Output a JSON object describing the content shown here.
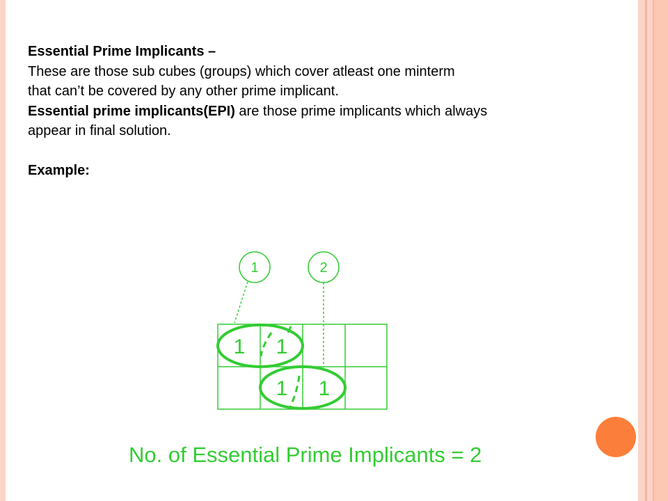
{
  "heading": "Essential Prime Implicants –",
  "line1": "These are those sub cubes (groups) which cover atleast one minterm",
  "line2": "that can’t be covered by any other prime implicant.",
  "epi_bold": "Essential prime implicants(EPI)",
  "epi_rest": " are those prime implicants which always",
  "line4": "appear in final solution.",
  "example_label": "Example:",
  "kmap": {
    "callout_1": "1",
    "callout_2": "2",
    "row1": [
      "1",
      "1",
      "",
      ""
    ],
    "row2": [
      "",
      "1",
      "1",
      ""
    ]
  },
  "result_text": "No. of Essential Prime Implicants = 2",
  "colors": {
    "diagram_green": "#33cc33",
    "accent_orange": "#fb7f3a",
    "stripe_peach": "#fbd5c8"
  }
}
